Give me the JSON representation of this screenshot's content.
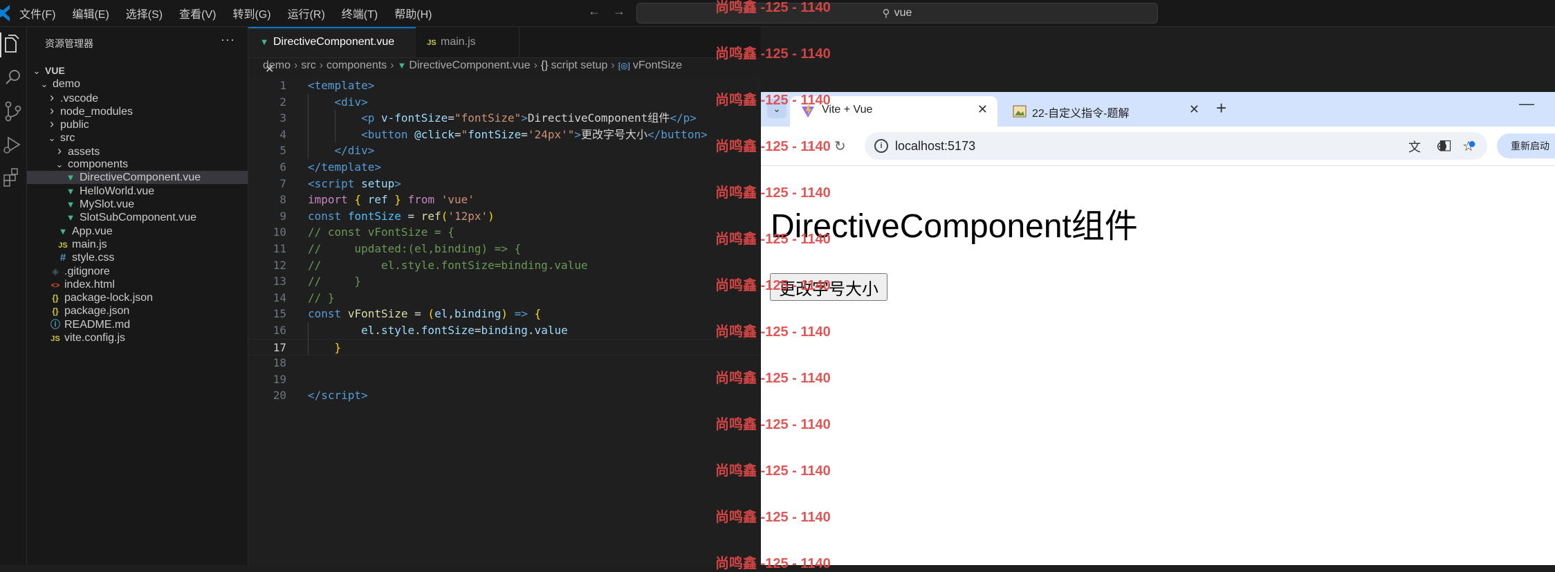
{
  "menu": [
    "文件(F)",
    "编辑(E)",
    "选择(S)",
    "查看(V)",
    "转到(G)",
    "运行(R)",
    "终端(T)",
    "帮助(H)"
  ],
  "command_center": {
    "text": "vue"
  },
  "sidebar": {
    "title": "资源管理器",
    "more": "···",
    "tree": [
      {
        "label": "VUE",
        "depth": 0,
        "chevron": "down",
        "icon": "",
        "bold": true
      },
      {
        "label": "demo",
        "depth": 1,
        "chevron": "down",
        "icon": ""
      },
      {
        "label": ".vscode",
        "depth": 2,
        "chevron": "right",
        "icon": ""
      },
      {
        "label": "node_modules",
        "depth": 2,
        "chevron": "right",
        "icon": ""
      },
      {
        "label": "public",
        "depth": 2,
        "chevron": "right",
        "icon": ""
      },
      {
        "label": "src",
        "depth": 2,
        "chevron": "down",
        "icon": ""
      },
      {
        "label": "assets",
        "depth": 3,
        "chevron": "right",
        "icon": ""
      },
      {
        "label": "components",
        "depth": 3,
        "chevron": "down",
        "icon": ""
      },
      {
        "label": "DirectiveComponent.vue",
        "depth": 4,
        "chevron": "",
        "icon": "vue",
        "selected": true
      },
      {
        "label": "HelloWorld.vue",
        "depth": 4,
        "chevron": "",
        "icon": "vue"
      },
      {
        "label": "MySlot.vue",
        "depth": 4,
        "chevron": "",
        "icon": "vue"
      },
      {
        "label": "SlotSubComponent.vue",
        "depth": 4,
        "chevron": "",
        "icon": "vue"
      },
      {
        "label": "App.vue",
        "depth": 3,
        "chevron": "",
        "icon": "vue"
      },
      {
        "label": "main.js",
        "depth": 3,
        "chevron": "",
        "icon": "js"
      },
      {
        "label": "style.css",
        "depth": 3,
        "chevron": "",
        "icon": "css"
      },
      {
        "label": ".gitignore",
        "depth": 2,
        "chevron": "",
        "icon": "git"
      },
      {
        "label": "index.html",
        "depth": 2,
        "chevron": "",
        "icon": "html"
      },
      {
        "label": "package-lock.json",
        "depth": 2,
        "chevron": "",
        "icon": "json"
      },
      {
        "label": "package.json",
        "depth": 2,
        "chevron": "",
        "icon": "json"
      },
      {
        "label": "README.md",
        "depth": 2,
        "chevron": "",
        "icon": "info"
      },
      {
        "label": "vite.config.js",
        "depth": 2,
        "chevron": "",
        "icon": "js"
      }
    ]
  },
  "editor": {
    "tabs": [
      {
        "label": "DirectiveComponent.vue",
        "icon": "vue",
        "active": true,
        "close": "✕"
      },
      {
        "label": "main.js",
        "icon": "js",
        "active": false
      }
    ],
    "breadcrumb": [
      "demo",
      "src",
      "components",
      "DirectiveComponent.vue",
      "script setup",
      "vFontSize"
    ],
    "current_line": 17,
    "lines": [
      [
        [
          "tg",
          "<"
        ],
        [
          "tg",
          "template"
        ],
        [
          "tg",
          ">"
        ]
      ],
      [
        [
          "tx",
          "    "
        ],
        [
          "tg",
          "<"
        ],
        [
          "tg",
          "div"
        ],
        [
          "tg",
          ">"
        ]
      ],
      [
        [
          "tx",
          "        "
        ],
        [
          "tg",
          "<"
        ],
        [
          "tg",
          "p"
        ],
        [
          "tx",
          " "
        ],
        [
          "at",
          "v-fontSize"
        ],
        [
          "tx",
          "="
        ],
        [
          "st",
          "\"fontSize\""
        ],
        [
          "tg",
          ">"
        ],
        [
          "tx",
          "DirectiveComponent组件"
        ],
        [
          "tg",
          "</"
        ],
        [
          "tg",
          "p"
        ],
        [
          "tg",
          ">"
        ]
      ],
      [
        [
          "tx",
          "        "
        ],
        [
          "tg",
          "<"
        ],
        [
          "tg",
          "button"
        ],
        [
          "tx",
          " "
        ],
        [
          "at",
          "@click"
        ],
        [
          "tx",
          "="
        ],
        [
          "st",
          "\""
        ],
        [
          "vr",
          "fontSize"
        ],
        [
          "tx",
          "="
        ],
        [
          "st",
          "'24px'"
        ],
        [
          "st",
          "\""
        ],
        [
          "tg",
          ">"
        ],
        [
          "tx",
          "更改字号大小"
        ],
        [
          "tg",
          "</"
        ],
        [
          "tg",
          "button"
        ],
        [
          "tg",
          ">"
        ]
      ],
      [
        [
          "tx",
          "    "
        ],
        [
          "tg",
          "</"
        ],
        [
          "tg",
          "div"
        ],
        [
          "tg",
          ">"
        ]
      ],
      [
        [
          "tg",
          "</"
        ],
        [
          "tg",
          "template"
        ],
        [
          "tg",
          ">"
        ]
      ],
      [
        [
          "tg",
          "<"
        ],
        [
          "tg",
          "script"
        ],
        [
          "tx",
          " "
        ],
        [
          "at",
          "setup"
        ],
        [
          "tg",
          ">"
        ]
      ],
      [
        [
          "kw",
          "import"
        ],
        [
          "tx",
          " "
        ],
        [
          "pn",
          "{"
        ],
        [
          "tx",
          " "
        ],
        [
          "vr",
          "ref"
        ],
        [
          "tx",
          " "
        ],
        [
          "pn",
          "}"
        ],
        [
          "tx",
          " "
        ],
        [
          "kw",
          "from"
        ],
        [
          "tx",
          " "
        ],
        [
          "st",
          "'vue'"
        ]
      ],
      [
        [
          "kb",
          "const"
        ],
        [
          "tx",
          " "
        ],
        [
          "cv",
          "fontSize"
        ],
        [
          "tx",
          " = "
        ],
        [
          "fn",
          "ref"
        ],
        [
          "pn",
          "("
        ],
        [
          "st",
          "'12px'"
        ],
        [
          "pn",
          ")"
        ]
      ],
      [
        [
          "cm",
          "// const vFontSize = {"
        ]
      ],
      [
        [
          "cm",
          "//     updated:(el,binding) => {"
        ]
      ],
      [
        [
          "cm",
          "//         el.style.fontSize=binding.value"
        ]
      ],
      [
        [
          "cm",
          "//     }"
        ]
      ],
      [
        [
          "cm",
          "// }"
        ]
      ],
      [
        [
          "kb",
          "const"
        ],
        [
          "tx",
          " "
        ],
        [
          "fn",
          "vFontSize"
        ],
        [
          "tx",
          " = "
        ],
        [
          "pn",
          "("
        ],
        [
          "vr",
          "el"
        ],
        [
          "tx",
          ","
        ],
        [
          "vr",
          "binding"
        ],
        [
          "pn",
          ")"
        ],
        [
          "tx",
          " "
        ],
        [
          "kb",
          "=>"
        ],
        [
          "tx",
          " "
        ],
        [
          "pn",
          "{"
        ]
      ],
      [
        [
          "tx",
          "        "
        ],
        [
          "vr",
          "el"
        ],
        [
          "tx",
          "."
        ],
        [
          "vr",
          "style"
        ],
        [
          "tx",
          "."
        ],
        [
          "vr",
          "fontSize"
        ],
        [
          "tx",
          "="
        ],
        [
          "vr",
          "binding"
        ],
        [
          "tx",
          "."
        ],
        [
          "vr",
          "value"
        ]
      ],
      [
        [
          "tx",
          "    "
        ],
        [
          "pn",
          "}"
        ]
      ],
      [],
      [],
      [
        [
          "tg",
          "</"
        ],
        [
          "tg",
          "script"
        ],
        [
          "tg",
          ">"
        ]
      ]
    ]
  },
  "browser": {
    "tabs": [
      {
        "title": "Vite + Vue",
        "active": true,
        "close": "✕"
      },
      {
        "title": "22-自定义指令-题解",
        "active": false,
        "close": "✕"
      }
    ],
    "new_tab": "+",
    "minimize": "—",
    "url": "localhost:5173",
    "reload_button": "重新启动",
    "page": {
      "heading": "DirectiveComponent组件",
      "button": "更改字号大小"
    }
  },
  "watermark": {
    "text": "尚鸣鑫 -125 - 1140",
    "rows": 13
  },
  "colors": {
    "accent": "#0078d4",
    "vue_green": "#41b883",
    "js_yellow": "#cbcb41",
    "watermark_red": "#e04848"
  }
}
